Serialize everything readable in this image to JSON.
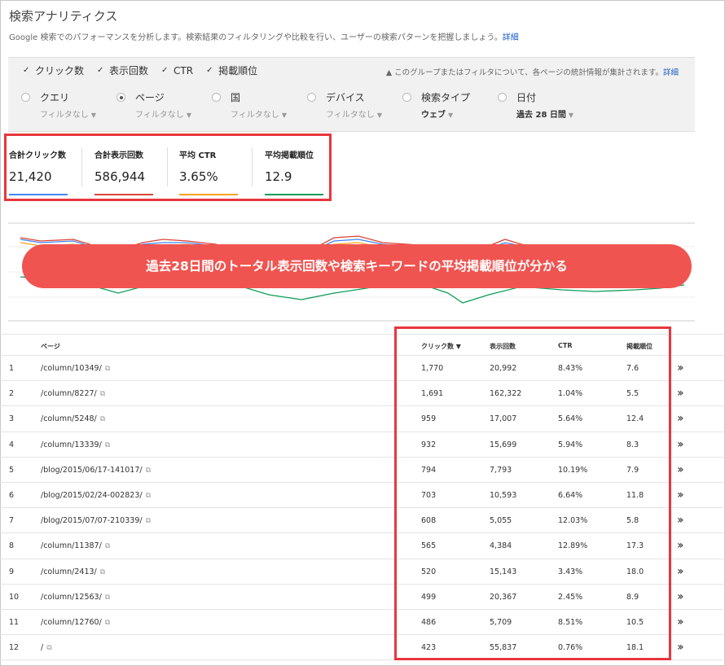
{
  "header": {
    "title": "検索アナリティクス",
    "description": "Google 検索でのパフォーマンスを分析します。検索結果のフィルタリングや比較を行い、ユーザーの検索パターンを把握しましょう。",
    "description_link": "詳細"
  },
  "filters": {
    "checkboxes": [
      {
        "label": "クリック数",
        "checked": true
      },
      {
        "label": "表示回数",
        "checked": true
      },
      {
        "label": "CTR",
        "checked": true
      },
      {
        "label": "掲載順位",
        "checked": true
      }
    ],
    "notice": "このグループまたはフィルタについて、各ページの統計情報が集計されます。",
    "notice_link": "詳細",
    "dimensions": [
      {
        "label": "クエリ",
        "sub": "フィルタなし",
        "selected": false
      },
      {
        "label": "ページ",
        "sub": "フィルタなし",
        "selected": true
      },
      {
        "label": "国",
        "sub": "フィルタなし",
        "selected": false
      },
      {
        "label": "デバイス",
        "sub": "フィルタなし",
        "selected": false
      },
      {
        "label": "検索タイプ",
        "sub": "ウェブ",
        "selected": false
      },
      {
        "label": "日付",
        "sub": "過去 28 日間",
        "selected": false
      }
    ]
  },
  "metrics": [
    {
      "label": "合計クリック数",
      "value": "21,420",
      "color": "#4285f4"
    },
    {
      "label": "合計表示回数",
      "value": "586,944",
      "color": "#db4437"
    },
    {
      "label": "平均 CTR",
      "value": "3.65%",
      "color": "#f4a21d"
    },
    {
      "label": "平均掲載順位",
      "value": "12.9",
      "color": "#0f9d58"
    }
  ],
  "banner": "過去28日間のトータル表示回数や検索キーワードの平均掲載順位が分かる",
  "table": {
    "headers": {
      "page": "ページ",
      "clicks": "クリック数 ▼",
      "impressions": "表示回数",
      "ctr": "CTR",
      "position": "掲載順位"
    },
    "rows": [
      {
        "n": "1",
        "page": "/column/10349/",
        "clicks": "1,770",
        "impressions": "20,992",
        "ctr": "8.43%",
        "position": "7.6"
      },
      {
        "n": "2",
        "page": "/column/8227/",
        "clicks": "1,691",
        "impressions": "162,322",
        "ctr": "1.04%",
        "position": "5.5"
      },
      {
        "n": "3",
        "page": "/column/5248/",
        "clicks": "959",
        "impressions": "17,007",
        "ctr": "5.64%",
        "position": "12.4"
      },
      {
        "n": "4",
        "page": "/column/13339/",
        "clicks": "932",
        "impressions": "15,699",
        "ctr": "5.94%",
        "position": "8.3"
      },
      {
        "n": "5",
        "page": "/blog/2015/06/17-141017/",
        "clicks": "794",
        "impressions": "7,793",
        "ctr": "10.19%",
        "position": "7.9"
      },
      {
        "n": "6",
        "page": "/blog/2015/02/24-002823/",
        "clicks": "703",
        "impressions": "10,593",
        "ctr": "6.64%",
        "position": "11.8"
      },
      {
        "n": "7",
        "page": "/blog/2015/07/07-210339/",
        "clicks": "608",
        "impressions": "5,055",
        "ctr": "12.03%",
        "position": "5.8"
      },
      {
        "n": "8",
        "page": "/column/11387/",
        "clicks": "565",
        "impressions": "4,384",
        "ctr": "12.89%",
        "position": "17.3"
      },
      {
        "n": "9",
        "page": "/column/2413/",
        "clicks": "520",
        "impressions": "15,143",
        "ctr": "3.43%",
        "position": "18.0"
      },
      {
        "n": "10",
        "page": "/column/12563/",
        "clicks": "499",
        "impressions": "20,367",
        "ctr": "2.45%",
        "position": "8.9"
      },
      {
        "n": "11",
        "page": "/column/12760/",
        "clicks": "486",
        "impressions": "5,709",
        "ctr": "8.51%",
        "position": "10.5"
      },
      {
        "n": "12",
        "page": "/",
        "clicks": "423",
        "impressions": "55,837",
        "ctr": "0.76%",
        "position": "18.1"
      }
    ]
  }
}
